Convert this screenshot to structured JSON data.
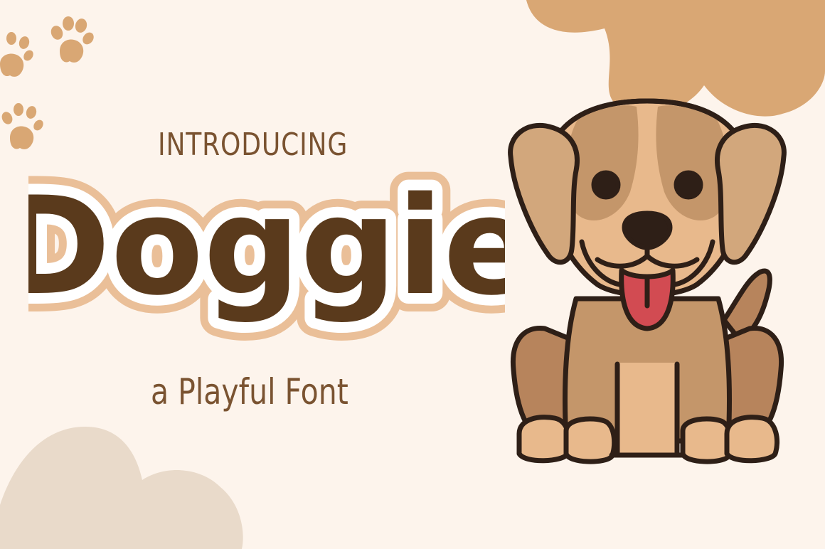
{
  "colors": {
    "background": "#FDF4EC",
    "blob_tan": "#D9A774",
    "blob_beige": "#E9DACA",
    "paw": "#D9A774",
    "intro_text": "#7A5331",
    "title_fill": "#5A3A1C",
    "title_outline_white": "#FFFFFF",
    "title_outline_peach": "#EABF98",
    "subtitle_text": "#7A5331",
    "dog_outline": "#2E1F17",
    "dog_fur_light": "#E8B98C",
    "dog_fur_mid": "#C4966A",
    "dog_fur_dark": "#B7845C",
    "dog_ear": "#D2A77C",
    "dog_tongue": "#D24B52"
  },
  "banner": {
    "intro": "INTRODUCING",
    "title": "Doggie",
    "subtitle": "a Playful Font"
  },
  "icons": {
    "paw": "paw-print-icon",
    "dog": "puppy-illustration"
  }
}
